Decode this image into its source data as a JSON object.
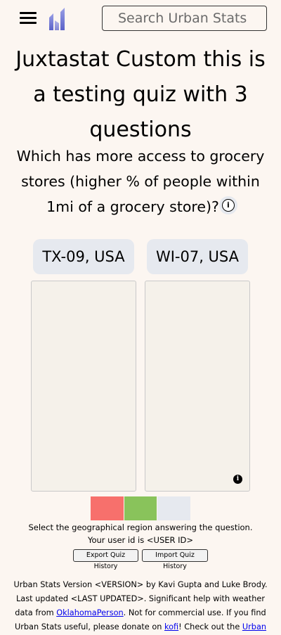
{
  "header": {
    "menu_icon": "hamburger-menu-icon",
    "logo_icon": "urban-stats-logo",
    "search_placeholder": "Search Urban Stats"
  },
  "quiz": {
    "title": "Juxtastat Custom this is a testing quiz with 3 questions",
    "question": "Which has more access to grocery stores (higher % of people within 1mi of a grocery store)?",
    "info_icon": "info-circle-icon",
    "info_glyph": "i",
    "choices": [
      {
        "label": "TX-09, USA"
      },
      {
        "label": "WI-07, USA"
      }
    ],
    "map_info_glyph": "i",
    "progress": [
      {
        "status": "wrong",
        "color": "#f7706c"
      },
      {
        "status": "correct",
        "color": "#89c35b"
      },
      {
        "status": "pending",
        "color": "#e6e9ef"
      }
    ],
    "instruction": "Select the geographical region answering the question.",
    "user_id_text": "Your user id is <USER ID>",
    "export_label": "Export Quiz History",
    "import_label": "Import Quiz History"
  },
  "footer": {
    "t1": "Urban Stats Version <VERSION> by Kavi Gupta and Luke Brody. Last updated <LAST UPDATED>. Significant help with weather data from ",
    "link1": "OklahomaPerson",
    "t2": ". Not for commercial use. If you find Urban Stats useful, please donate on ",
    "link2": "kofi",
    "t3": "! Check out the ",
    "link3": "Urban Stats Store",
    "t4": "!"
  },
  "colors": {
    "background": "#fcf6f1",
    "button_bg": "#e6e9ef",
    "map_bg": "#f5f1ea",
    "link": "#0000ee"
  }
}
